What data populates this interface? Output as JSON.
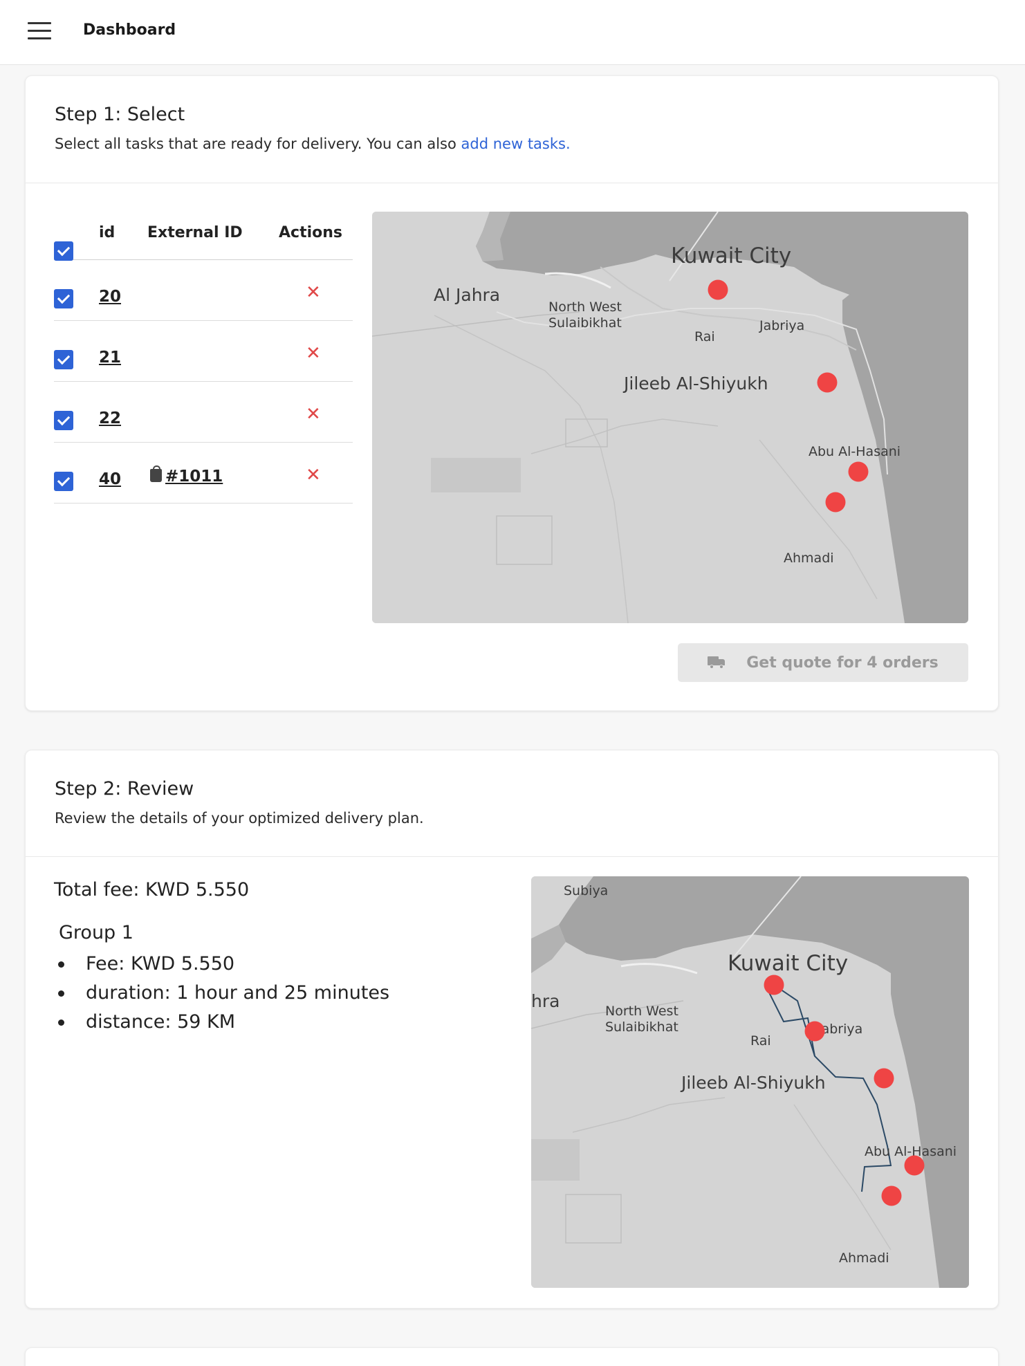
{
  "header": {
    "title": "Dashboard"
  },
  "step1": {
    "title": "Step 1: Select",
    "subtitle_prefix": "Select all tasks that are ready for delivery. You can also ",
    "subtitle_link": "add new tasks.",
    "table": {
      "columns": [
        "id",
        "External ID",
        "Actions"
      ],
      "rows": [
        {
          "id": "20",
          "external_id": "",
          "checked": true
        },
        {
          "id": "21",
          "external_id": "",
          "checked": true
        },
        {
          "id": "22",
          "external_id": "",
          "checked": true
        },
        {
          "id": "40",
          "external_id": "#1011",
          "external_icon": "shopify-bag-icon",
          "checked": true
        }
      ],
      "remove_glyph": "✕"
    },
    "map_labels": {
      "kuwait_city": "Kuwait City",
      "al_jahra": "Al Jahra",
      "north_west_1": "North West",
      "north_west_2": "Sulaibikhat",
      "rai": "Rai",
      "jabriya": "Jabriya",
      "jileeb": "Jileeb Al-Shiyukh",
      "abu_al_hasani": "Abu Al-Hasani",
      "ahmadi": "Ahmadi"
    },
    "quote_button": {
      "label": "Get quote for 4 orders",
      "icon": "truck-icon",
      "disabled": true
    }
  },
  "step2": {
    "title": "Step 2: Review",
    "subtitle": "Review the details of your optimized delivery plan.",
    "total_fee": "Total fee: KWD 5.550",
    "group": {
      "title": "Group 1",
      "items": [
        "Fee: KWD 5.550",
        "duration: 1 hour and 25 minutes",
        "distance: 59 KM"
      ]
    },
    "map_labels": {
      "subiya": "Subiya",
      "kuwait_city": "Kuwait City",
      "al_jahra_partial": "hra",
      "north_west_1": "North West",
      "north_west_2": "Sulaibikhat",
      "rai": "Rai",
      "jabriya": "Jabriya",
      "jileeb": "Jileeb Al-Shiyukh",
      "abu_al_hasani": "Abu Al-Hasani",
      "ahmadi": "Ahmadi"
    }
  },
  "colors": {
    "accent": "#2e63d6",
    "marker": "#ef4444",
    "remove": "#e04848",
    "route": "#2c4a66"
  }
}
